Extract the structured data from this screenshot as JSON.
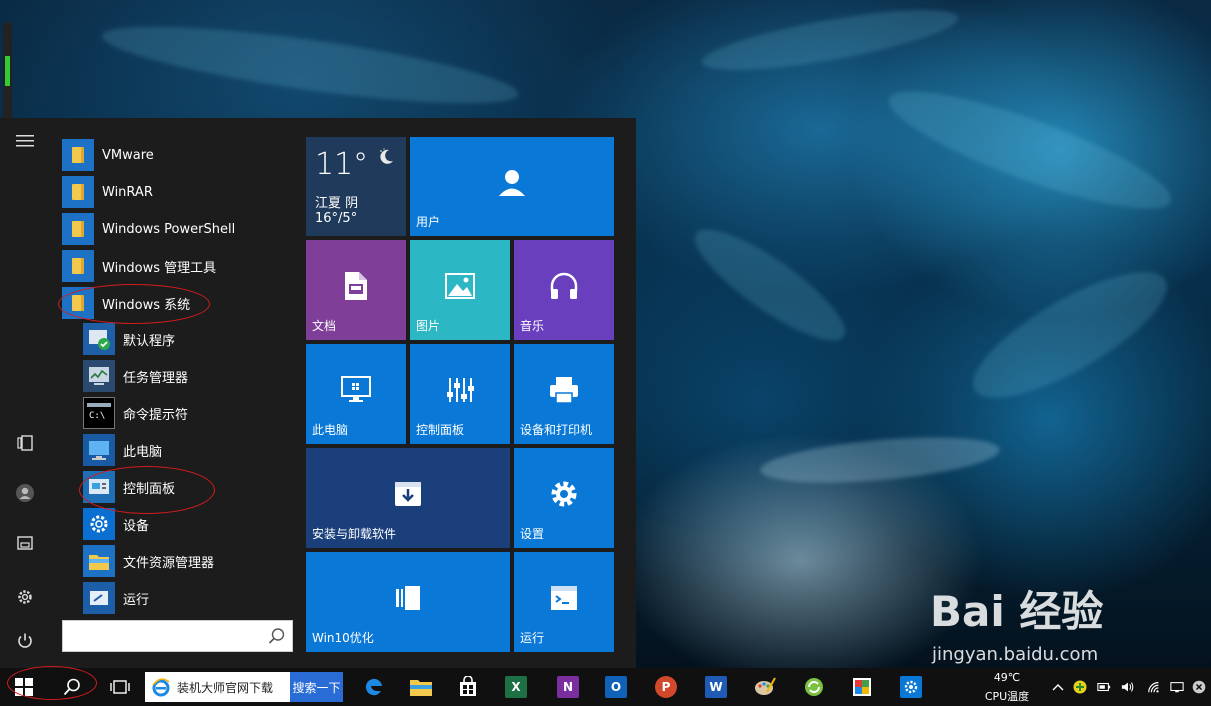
{
  "start_menu": {
    "apps": [
      {
        "label": "VMware",
        "icon": "folder-icon"
      },
      {
        "label": "WinRAR",
        "icon": "folder-icon"
      },
      {
        "label": "Windows PowerShell",
        "icon": "folder-icon"
      },
      {
        "label": "Windows 管理工具",
        "icon": "folder-icon"
      },
      {
        "label": "Windows 系统",
        "icon": "folder-icon"
      },
      {
        "label": "默认程序",
        "icon": "default-programs-icon"
      },
      {
        "label": "任务管理器",
        "icon": "task-manager-icon"
      },
      {
        "label": "命令提示符",
        "icon": "command-prompt-icon"
      },
      {
        "label": "此电脑",
        "icon": "this-pc-icon"
      },
      {
        "label": "控制面板",
        "icon": "control-panel-icon"
      },
      {
        "label": "设备",
        "icon": "gear-icon"
      },
      {
        "label": "文件资源管理器",
        "icon": "file-explorer-icon"
      },
      {
        "label": "运行",
        "icon": "run-icon"
      }
    ],
    "search_value": ""
  },
  "tiles": {
    "weather": {
      "temp": "11°",
      "city": "江夏 阴",
      "range": "16°/5°"
    },
    "user": "用户",
    "documents": "文档",
    "pictures": "图片",
    "music": "音乐",
    "this_pc": "此电脑",
    "control_panel": "控制面板",
    "devices_printers": "设备和打印机",
    "install_uninstall": "安装与卸载软件",
    "settings": "设置",
    "win10_opt": "Win10优化",
    "run": "运行"
  },
  "taskbar": {
    "search_value": "装机大师官网下载",
    "search_button": "搜索一下",
    "cpu_temp": "49℃",
    "cpu_label": "CPU温度",
    "pinned": [
      "edge-icon",
      "file-explorer-icon",
      "store-icon",
      "excel-icon",
      "onenote-icon",
      "outlook-icon",
      "powerpoint-icon",
      "word-icon",
      "paint-icon",
      "refresh-app-icon",
      "photo-app-icon",
      "settings-icon"
    ]
  },
  "watermark": {
    "brand": "Bai 经验",
    "url": "jingyan.baidu.com"
  },
  "colors": {
    "tile_blue": "#0a78d7",
    "tile_purple": "#7f3e98",
    "tile_teal": "#2cb7c5",
    "tile_violet": "#6a3fbd",
    "tile_navy": "#1a3f7a",
    "weather_bg": "#1f3a5a",
    "annotation_red": "#d41c1c"
  }
}
